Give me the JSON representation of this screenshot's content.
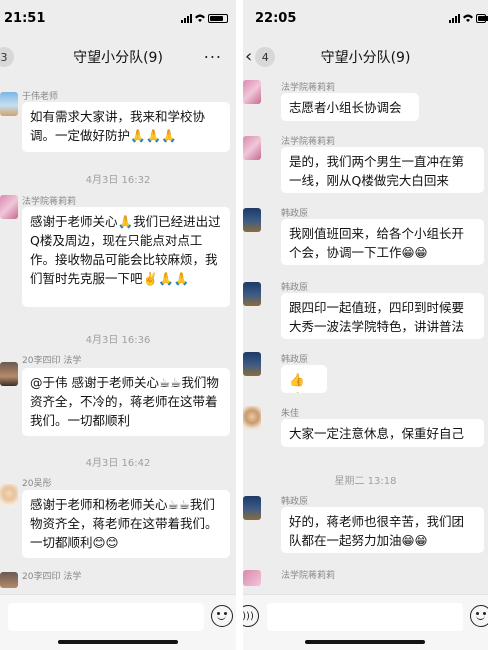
{
  "left": {
    "time": "21:51",
    "title": "守望小分队(9)",
    "unread_badge": "3",
    "messages": [
      {
        "sender": "于伟老师",
        "text": "如有需求大家讲，我来和学校协调。一定做好防护🙏🙏🙏"
      },
      {
        "timestamp": "4月3日 16:32"
      },
      {
        "sender": "法学院蒋莉莉",
        "text": "感谢于老师关心🙏我们已经进出过Q楼及周边，现在只能点对点工作。接收物品可能会比较麻烦，我们暂时先克服一下吧✌️🙏🙏"
      },
      {
        "timestamp": "4月3日 16:36"
      },
      {
        "sender": "20李四印 法学",
        "text": "@于伟 感谢于老师关心☕☕我们物资齐全，不冷的，蒋老师在这带着我们。一切都顺利"
      },
      {
        "timestamp": "4月3日 16:42"
      },
      {
        "sender": "20吴彤",
        "text": "感谢于老师和杨老师关心☕☕我们物资齐全，蒋老师在这带着我们。一切都顺利😊😊"
      },
      {
        "sender": "20李四印 法学"
      }
    ]
  },
  "right": {
    "time": "22:05",
    "title": "守望小分队(9)",
    "unread_badge": "4",
    "messages": [
      {
        "sender": "法学院蒋莉莉",
        "text": "志愿者小组长协调会"
      },
      {
        "sender": "法学院蒋莉莉",
        "text": "是的，我们两个男生一直冲在第一线，刚从Q楼做完大白回来"
      },
      {
        "sender": "韩政原",
        "text": "我刚值班回来，给各个小组长开个会，协调一下工作😁😁"
      },
      {
        "sender": "韩政原",
        "text": "跟四印一起值班，四印到时候要大秀一波法学院特色，讲讲普法"
      },
      {
        "sender": "韩政原",
        "text": "👍👍"
      },
      {
        "sender": "朱佳",
        "text": "大家一定注意休息，保重好自己"
      },
      {
        "timestamp": "星期二 13:18"
      },
      {
        "sender": "韩政原",
        "text": "好的，蒋老师也很辛苦，我们团队都在一起努力加油😁😁"
      },
      {
        "sender": "法学院蒋莉莉"
      }
    ]
  },
  "colors": {
    "chat_bg": "#ededed",
    "bubble_bg": "#ffffff",
    "text": "#111111",
    "meta_text": "#a0a0a0"
  },
  "icons": [
    "signal-icon",
    "wifi-icon",
    "battery-icon",
    "back-chevron-icon",
    "emoji-icon",
    "voice-icon",
    "plus-icon"
  ]
}
